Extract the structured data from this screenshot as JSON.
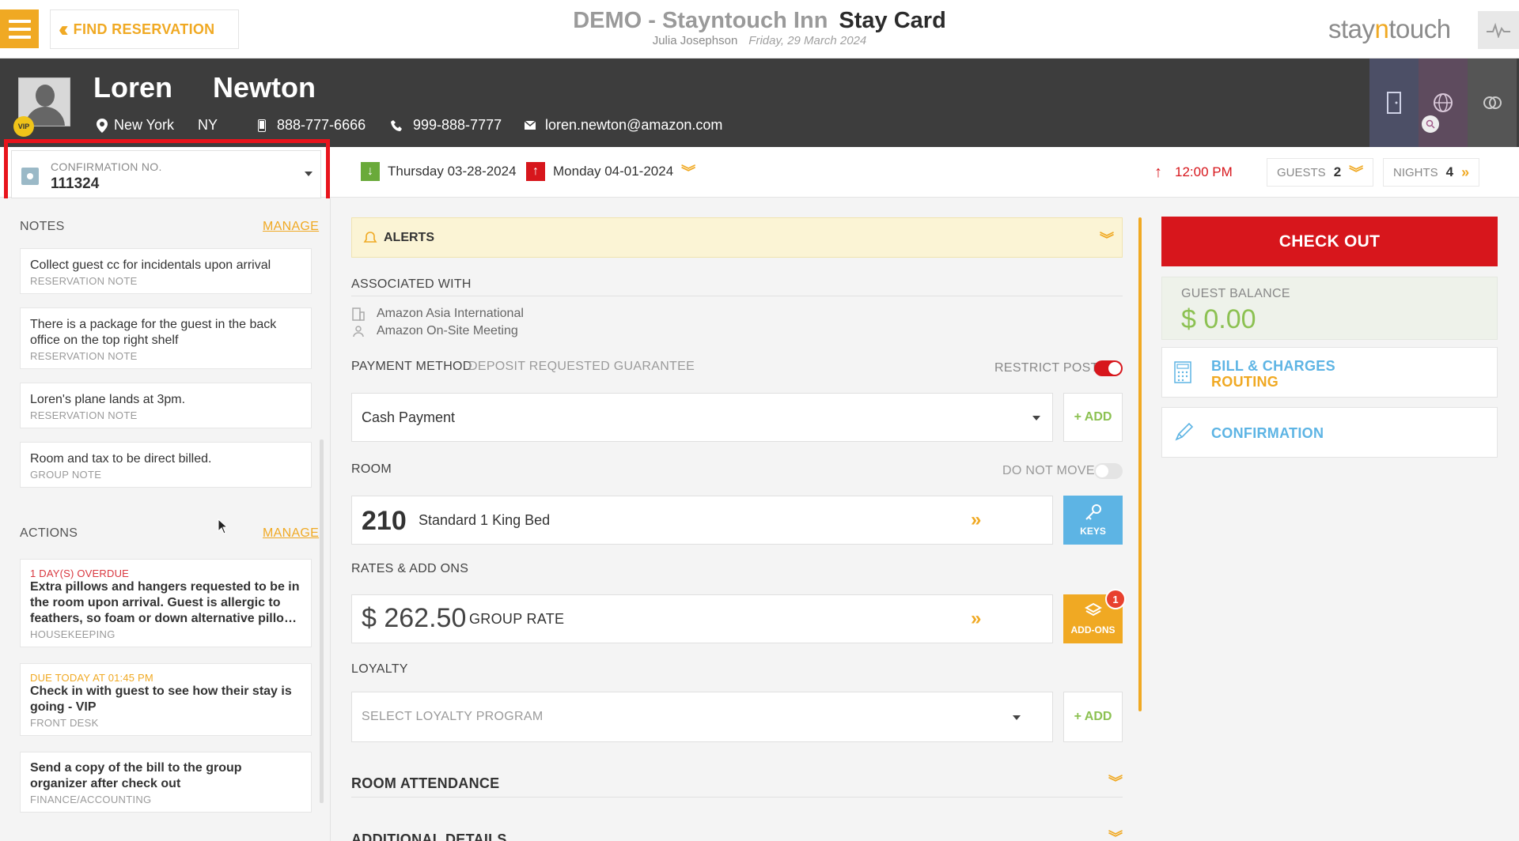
{
  "topbar": {
    "find_reservation_label": "FIND RESERVATION",
    "hotel_name": "DEMO - Stayntouch Inn",
    "screen_title": "Stay Card",
    "user_name": "Julia Josephson",
    "business_date": "Friday, 29 March 2024",
    "brand_part1": "stay",
    "brand_part2": "n",
    "brand_part3": "touch"
  },
  "guest": {
    "first_name": "Loren",
    "last_name": "Newton",
    "vip_label": "VIP",
    "city": "New York",
    "state": "NY",
    "mobile": "888-777-6666",
    "phone": "999-888-7777",
    "email": "loren.newton@amazon.com"
  },
  "reservation": {
    "confirmation_label": "CONFIRMATION NO.",
    "confirmation_number": "111324",
    "arrival_date": "Thursday 03-28-2024",
    "departure_date": "Monday 04-01-2024",
    "departure_time": "12:00 PM",
    "guests_label": "GUESTS",
    "guests_count": "2",
    "nights_label": "NIGHTS",
    "nights_count": "4"
  },
  "notes": {
    "header": "NOTES",
    "manage_label": "MANAGE",
    "items": [
      {
        "text": "Collect guest cc for incidentals upon arrival",
        "category": "RESERVATION NOTE"
      },
      {
        "text": "There is a package for the guest in the back office on the top right shelf",
        "category": "RESERVATION NOTE"
      },
      {
        "text": "Loren's plane lands at 3pm.",
        "category": "RESERVATION NOTE"
      },
      {
        "text": "Room and tax to be direct billed.",
        "category": "GROUP NOTE"
      }
    ]
  },
  "actions": {
    "header": "ACTIONS",
    "manage_label": "MANAGE",
    "items": [
      {
        "due": "1 DAY(S) OVERDUE",
        "due_color": "#d9363e",
        "text": "Extra pillows and hangers requested to be in the room upon arrival. Guest is allergic to feathers, so foam or down alternative pillo…",
        "department": "HOUSEKEEPING"
      },
      {
        "due": "DUE TODAY AT 01:45 PM",
        "due_color": "#f0a923",
        "text": "Check in with guest to see how their stay is going - VIP",
        "department": "FRONT DESK"
      },
      {
        "due": "",
        "due_color": "#f0a923",
        "text": "Send a copy of the bill to the group organizer after check out",
        "department": "FINANCE/ACCOUNTING"
      }
    ]
  },
  "center": {
    "alerts_label": "ALERTS",
    "associated_with_label": "ASSOCIATED WITH",
    "company": "Amazon Asia International",
    "group": "Amazon On-Site Meeting",
    "payment_method_label": "PAYMENT METHOD",
    "payment_sub_label": "DEPOSIT REQUESTED GUARANTEE",
    "restrict_post_label": "RESTRICT POST",
    "restrict_post_on": true,
    "payment_value": "Cash Payment",
    "add_label": "+ ADD",
    "room_label": "ROOM",
    "do_not_move_label": "DO NOT MOVE",
    "do_not_move_on": false,
    "room_number": "210",
    "room_type": "Standard 1 King Bed",
    "keys_label": "KEYS",
    "rates_label": "RATES & ADD ONS",
    "rate_amount": "$ 262.50",
    "rate_name": "GROUP RATE",
    "addons_label": "ADD-ONS",
    "addons_count": "1",
    "loyalty_label": "LOYALTY",
    "loyalty_placeholder": "SELECT LOYALTY PROGRAM",
    "room_attendance_label": "ROOM ATTENDANCE",
    "additional_details_label": "ADDITIONAL DETAILS"
  },
  "right": {
    "checkout_label": "CHECK OUT",
    "guest_balance_label": "GUEST BALANCE",
    "guest_balance_value": "$ 0.00",
    "bill_routing_line1": "BILL & CHARGES",
    "bill_routing_line2": "ROUTING",
    "confirmation_label": "CONFIRMATION"
  },
  "colors": {
    "accent": "#f0a923",
    "checkout_red": "#d7161c",
    "link_blue": "#5db4e4",
    "balance_green": "#8cc152"
  }
}
